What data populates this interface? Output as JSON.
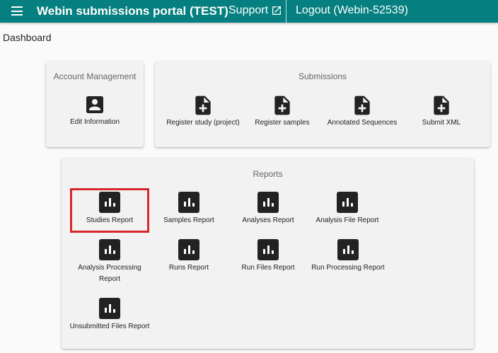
{
  "header": {
    "title": "Webin submissions portal (TEST)",
    "support_label": "Support",
    "logout_label": "Logout (Webin-52539)",
    "background_color": "#057f7f"
  },
  "dashboard_label": "Dashboard",
  "account_management": {
    "title": "Account Management",
    "items": [
      {
        "label": "Edit Information",
        "icon": "account-box-icon"
      }
    ]
  },
  "submissions": {
    "title": "Submissions",
    "items": [
      {
        "label": "Register study (project)",
        "icon": "note-add-icon"
      },
      {
        "label": "Register samples",
        "icon": "note-add-icon"
      },
      {
        "label": "Annotated Sequences",
        "icon": "note-add-icon"
      },
      {
        "label": "Submit XML",
        "icon": "note-add-icon"
      }
    ]
  },
  "reports": {
    "title": "Reports",
    "highlight_color": "#d9262b",
    "items": [
      {
        "label": "Studies Report",
        "icon": "bar-chart-icon",
        "highlighted": true
      },
      {
        "label": "Samples Report",
        "icon": "bar-chart-icon"
      },
      {
        "label": "Analyses Report",
        "icon": "bar-chart-icon"
      },
      {
        "label": "Analysis File Report",
        "icon": "bar-chart-icon"
      },
      {
        "label": "Analysis Processing Report",
        "icon": "bar-chart-icon"
      },
      {
        "label": "Runs Report",
        "icon": "bar-chart-icon"
      },
      {
        "label": "Run Files Report",
        "icon": "bar-chart-icon"
      },
      {
        "label": "Run Processing Report",
        "icon": "bar-chart-icon"
      },
      {
        "label": "Unsubmitted Files Report",
        "icon": "bar-chart-icon"
      }
    ]
  }
}
